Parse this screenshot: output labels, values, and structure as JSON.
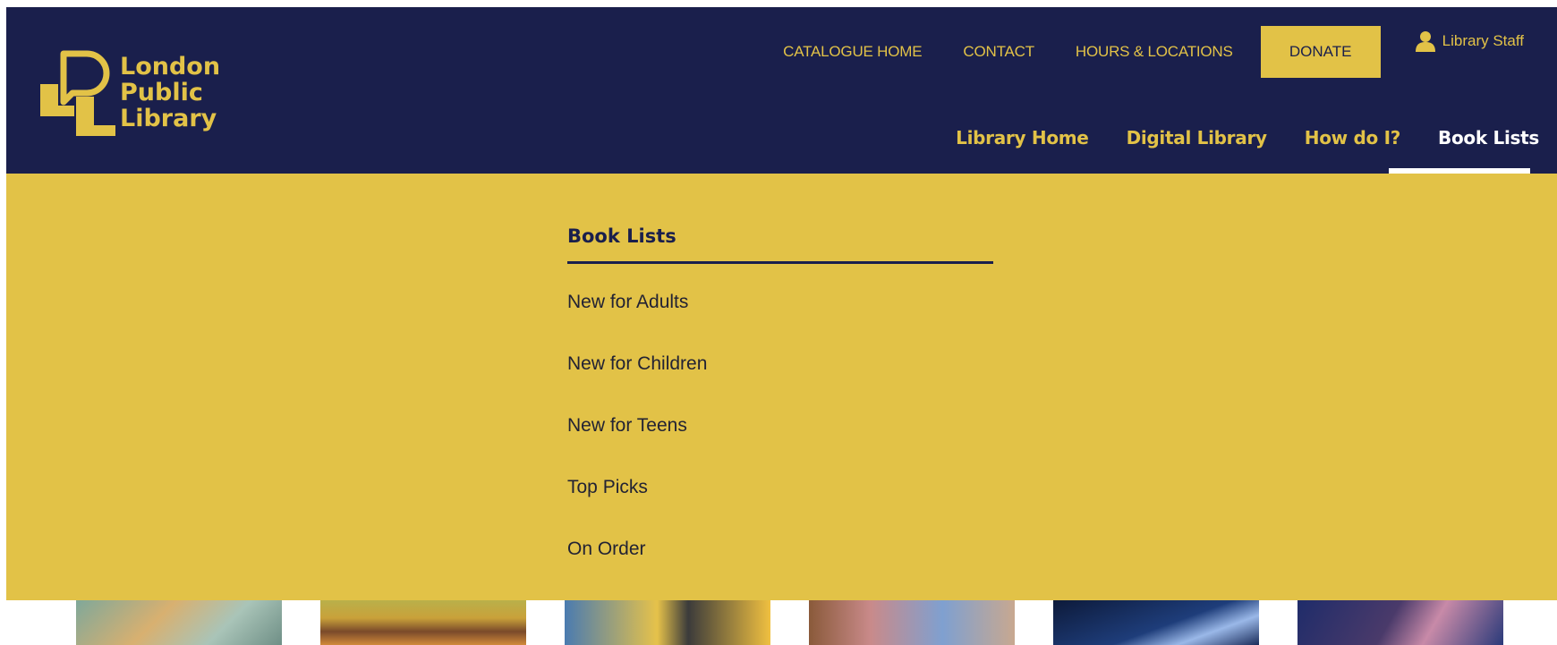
{
  "logo": {
    "lines": [
      "London",
      "Public",
      "Library"
    ]
  },
  "utility_nav": {
    "catalogue_home": "CATALOGUE HOME",
    "contact": "CONTACT",
    "hours_locations": "HOURS & LOCATIONS",
    "donate": "DONATE",
    "library_staff": "Library Staff"
  },
  "main_nav": {
    "items": [
      "Library Home",
      "Digital Library",
      "How do I?",
      "Book Lists"
    ],
    "active": "Book Lists"
  },
  "dropdown": {
    "heading": "Book Lists",
    "items": [
      "New for Adults",
      "New for Children",
      "New for Teens",
      "Top Picks",
      "On Order"
    ]
  },
  "colors": {
    "navy": "#1a1f4c",
    "gold": "#e2c247",
    "white": "#ffffff"
  }
}
